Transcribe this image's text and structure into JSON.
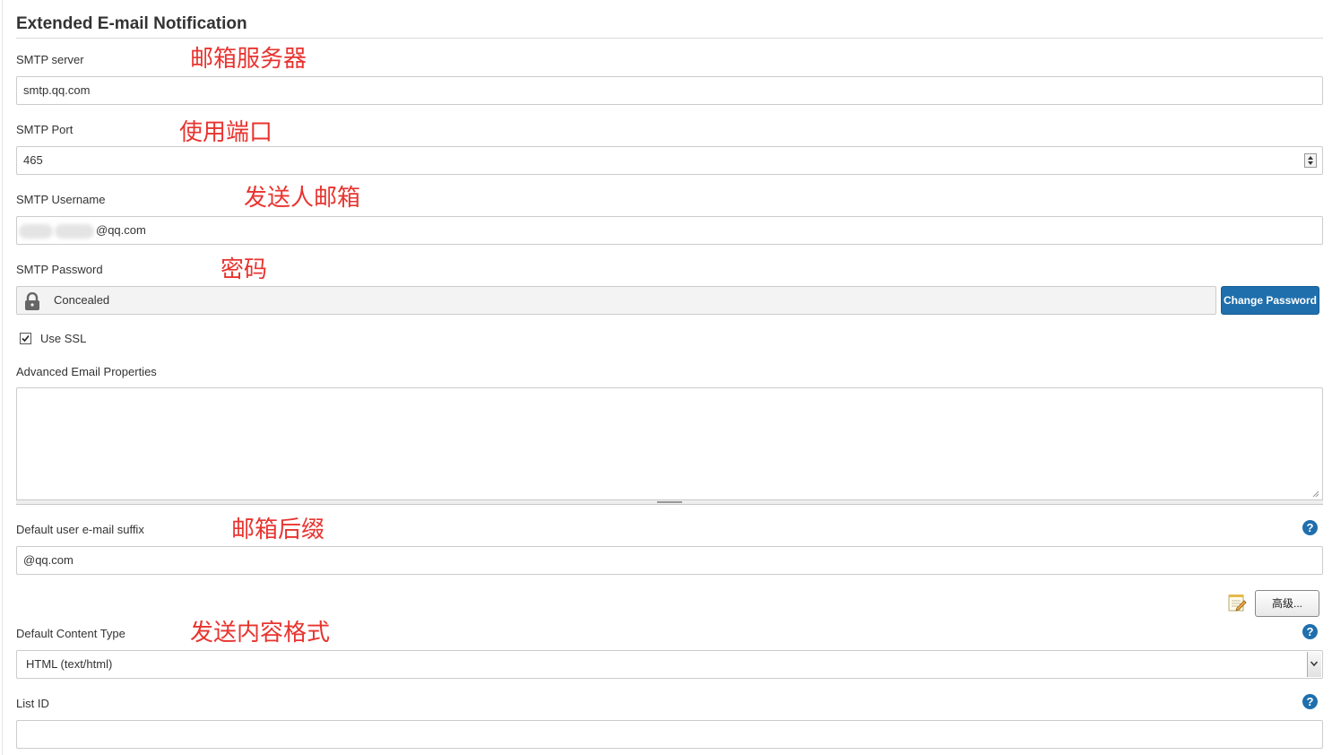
{
  "section": {
    "title": "Extended E-mail Notification"
  },
  "fields": {
    "smtp_server": {
      "label": "SMTP server",
      "value": "smtp.qq.com",
      "annotation": "邮箱服务器"
    },
    "smtp_port": {
      "label": "SMTP Port",
      "value": "465",
      "annotation": "使用端口"
    },
    "smtp_username": {
      "label": "SMTP Username",
      "value_visible_suffix": "@qq.com",
      "annotation": "发送人邮箱"
    },
    "smtp_password": {
      "label": "SMTP Password",
      "status": "Concealed",
      "change_button": "Change Password",
      "annotation": "密码"
    },
    "use_ssl": {
      "label": "Use SSL",
      "checked": true
    },
    "advanced_email_properties": {
      "label": "Advanced Email Properties",
      "value": ""
    },
    "default_suffix": {
      "label": "Default user e-mail suffix",
      "value": "@qq.com",
      "annotation": "邮箱后缀"
    },
    "advanced_button": {
      "label": "高级..."
    },
    "default_content_type": {
      "label": "Default Content Type",
      "selected": "HTML (text/html)",
      "annotation": "发送内容格式"
    },
    "list_id": {
      "label": "List ID",
      "value": ""
    }
  },
  "colors": {
    "annotation": "#e8342f",
    "primary_button": "#1f6fad",
    "help_icon": "#1f6fad"
  },
  "icons": {
    "lock": "lock-icon",
    "help": "help-icon",
    "notepad": "notepad-icon"
  }
}
